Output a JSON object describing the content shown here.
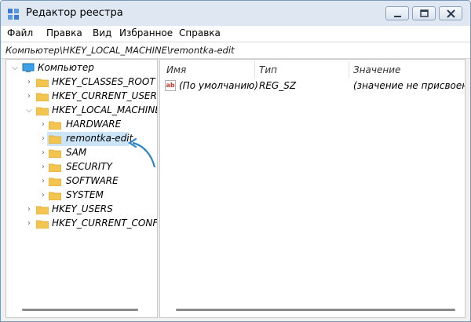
{
  "window": {
    "title": "Редактор реестра",
    "controls": {
      "minimize": "minimize",
      "maximize": "maximize",
      "close": "close"
    }
  },
  "menu": {
    "items": [
      "Файл",
      "Правка",
      "Вид",
      "Избранное",
      "Справка"
    ]
  },
  "address": {
    "path": "Компьютер\\HKEY_LOCAL_MACHINE\\remontka-edit"
  },
  "tree": {
    "root": "Компьютер",
    "nodes": [
      {
        "label": "HKEY_CLASSES_ROOT",
        "level": 1,
        "expanded": false
      },
      {
        "label": "HKEY_CURRENT_USER",
        "level": 1,
        "expanded": false
      },
      {
        "label": "HKEY_LOCAL_MACHINE",
        "level": 1,
        "expanded": true
      },
      {
        "label": "HARDWARE",
        "level": 2,
        "expanded": false
      },
      {
        "label": "remontka-edit",
        "level": 2,
        "expanded": false,
        "selected": true
      },
      {
        "label": "SAM",
        "level": 2,
        "expanded": false
      },
      {
        "label": "SECURITY",
        "level": 2,
        "expanded": false
      },
      {
        "label": "SOFTWARE",
        "level": 2,
        "expanded": false
      },
      {
        "label": "SYSTEM",
        "level": 2,
        "expanded": false
      },
      {
        "label": "HKEY_USERS",
        "level": 1,
        "expanded": false
      },
      {
        "label": "HKEY_CURRENT_CONFIG",
        "level": 1,
        "expanded": false
      }
    ]
  },
  "values_pane": {
    "columns": {
      "name": "Имя",
      "type": "Тип",
      "value": "Значение"
    },
    "rows": [
      {
        "icon": "ab",
        "name": "(По умолчанию)",
        "type": "REG_SZ",
        "value": "(значение не присвоено)"
      }
    ]
  },
  "colors": {
    "selection": "#cce4f7",
    "folder": "#f3c44f",
    "arrow": "#2f86c5"
  }
}
